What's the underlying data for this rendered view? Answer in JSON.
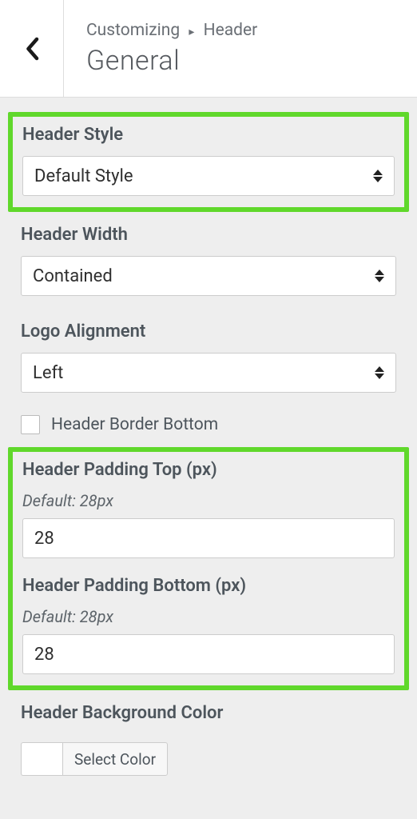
{
  "header": {
    "breadcrumb_root": "Customizing",
    "breadcrumb_item": "Header",
    "title": "General"
  },
  "fields": {
    "headerStyle": {
      "label": "Header Style",
      "value": "Default Style"
    },
    "headerWidth": {
      "label": "Header Width",
      "value": "Contained"
    },
    "logoAlignment": {
      "label": "Logo Alignment",
      "value": "Left"
    },
    "headerBorderBottom": {
      "label": "Header Border Bottom",
      "checked": false
    },
    "paddingTop": {
      "label": "Header Padding Top (px)",
      "hint": "Default: 28px",
      "value": "28"
    },
    "paddingBottom": {
      "label": "Header Padding Bottom (px)",
      "hint": "Default: 28px",
      "value": "28"
    },
    "bgColor": {
      "label": "Header Background Color",
      "button": "Select Color",
      "swatch": "#ffffff"
    }
  },
  "highlightColor": "#60d82b"
}
